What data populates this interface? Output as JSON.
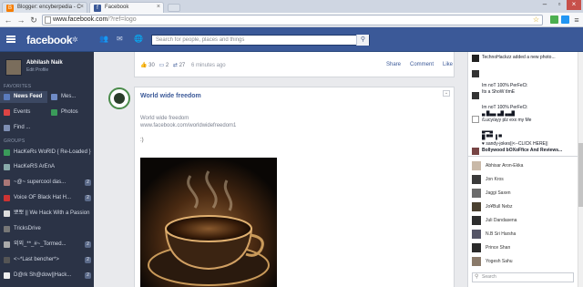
{
  "browser": {
    "tabs": [
      {
        "title": "Blogger: encyberpedia - C",
        "favicon": "blogger-icon"
      },
      {
        "title": "Facebook",
        "favicon": "facebook-icon"
      }
    ],
    "url_host": "www.facebook.com",
    "url_rest": "/?ref=logo"
  },
  "fb": {
    "logo": "facebook",
    "search_placeholder": "Search for people, places and things"
  },
  "profile": {
    "name": "Abhilash Naik",
    "edit": "Edit Profile"
  },
  "sidebar": {
    "favorites_title": "FAVORITES",
    "groups_title": "GROUPS",
    "favorites": [
      {
        "label": "News Feed",
        "icon": "news-feed-icon"
      },
      {
        "label": "Mes...",
        "icon": "messages-icon"
      },
      {
        "label": "Events",
        "icon": "events-icon"
      },
      {
        "label": "Photos",
        "icon": "photos-icon"
      },
      {
        "label": "Find ...",
        "icon": "find-friends-icon"
      }
    ],
    "groups": [
      {
        "label": "HacKeRs WoRlD { Re-Loaded }",
        "count": ""
      },
      {
        "label": "HacKeRS ArEnA",
        "count": ""
      },
      {
        "label": "~@~ supercool das...",
        "count": "2"
      },
      {
        "label": "Voice OF Black Hat H...",
        "count": "2"
      },
      {
        "label": "뽀뽀 || We Hack With a Passion",
        "count": ""
      },
      {
        "label": "TricksDrive",
        "count": ""
      },
      {
        "label": "외외_**_#~_Tormed...",
        "count": "2"
      },
      {
        "label": "<~*Last bencher*>",
        "count": "2"
      },
      {
        "label": "D@rk Sh@dow||Hack...",
        "count": "2"
      }
    ]
  },
  "feed": {
    "prev_post": {
      "likes": "30",
      "comments": "2",
      "shares": "27",
      "time": "6 minutes ago",
      "actions": [
        "Share",
        "Comment",
        "Like"
      ]
    },
    "post": {
      "page_name": "World wide freedom",
      "line1": "World wide freedom",
      "line2": "www.facebook.com/worldwidefreedom1",
      "line3": ":)"
    }
  },
  "ticker": [
    {
      "text": "TechnoHackzz added a new photo..."
    },
    {
      "text": "Im noT 100% PerFeCt\nIts a ShoW tImE"
    },
    {
      "text": "Im noT 100% PerFeCt\n▄ █▄▄ ▄█ ▄▄█\n/Lucy/ayy plz exx my Me"
    },
    {
      "text": "▄▬▄\n█ ▀▀ ▐ ▀\n♥ sandy-jokes||<--CLICK HERE||"
    },
    {
      "text": "Bollywood bOXoFfice And Reviews..."
    }
  ],
  "chat": [
    "Abhisar Aron-Ekka",
    "Jon Kros",
    "Jaggi Saxen",
    "Jo¥Bull Nebz",
    "Juli Dandasena",
    "N.B Sri Harsha",
    "Prince Shan",
    "Yogesh Sahu"
  ],
  "chat_search": "Search",
  "colors": {
    "fb_blue": "#3b5998",
    "sidebar_bg": "#2b3346"
  }
}
